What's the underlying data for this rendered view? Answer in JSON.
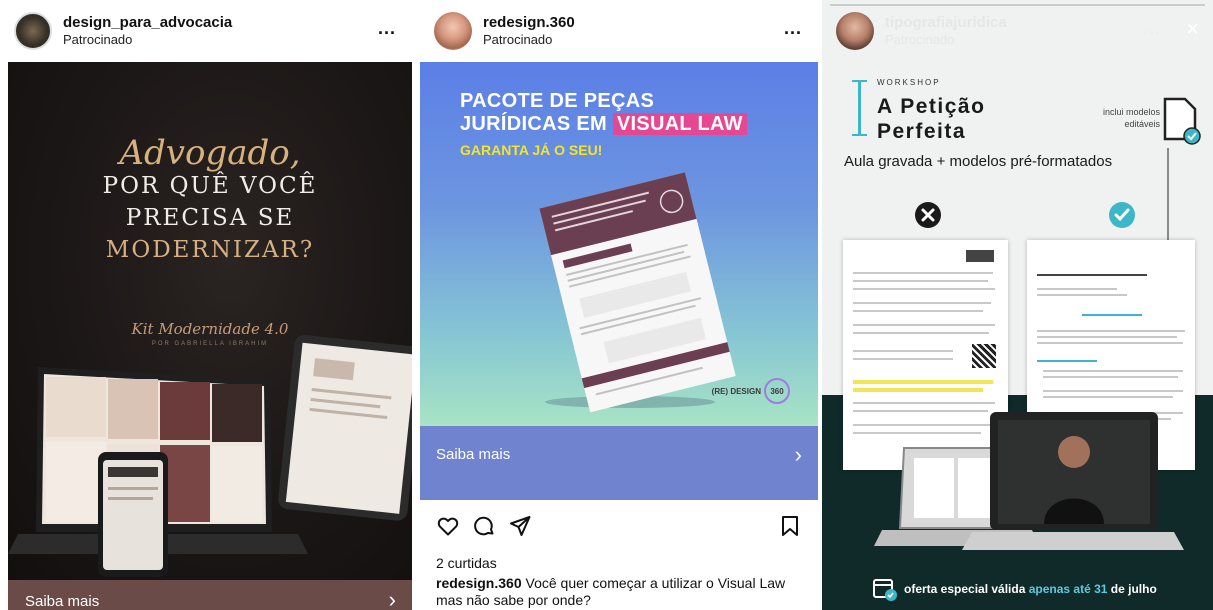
{
  "post1": {
    "username": "design_para_advocacia",
    "sponsored": "Patrocinado",
    "more_label": "...",
    "headline_script": "Advogado,",
    "headline_lines": [
      "POR QUÊ VOCÊ",
      "PRECISA SE",
      "MODERNIZAR?"
    ],
    "kit_label": "Kit Modernidade 4.0",
    "kit_author": "POR GABRIELLA IBRAHIM",
    "cta_label": "Saiba mais",
    "cta_chevron": "›"
  },
  "post2": {
    "username": "redesign.360",
    "sponsored": "Patrocinado",
    "more_label": "...",
    "headline_line1": "PACOTE DE PEÇAS",
    "headline_line2_prefix": "JURÍDICAS EM ",
    "headline_highlight": "VISUAL LAW",
    "subheadline": "GARANTA JÁ O SEU!",
    "brand_mark": "(RE) DESIGN",
    "brand_number": "360",
    "cta_label": "Saiba mais",
    "cta_chevron": "›",
    "likes": "2 curtidas",
    "caption_user": "redesign.360",
    "caption_text": " Você quer começar a utilizar o Visual Law mas não sabe por onde?"
  },
  "post3": {
    "username": "tipografiajuridica",
    "sponsored": "Patrocinado",
    "more_label": "...",
    "close_icon": "×",
    "workshop_label": "WORKSHOP",
    "title_line1": "A Petição",
    "title_line2": "Perfeita",
    "includes_label": "inclui modelos editáveis",
    "subtitle": "Aula gravada + modelos pré-formatados",
    "offer_prefix": "oferta especial válida ",
    "offer_highlight": "apenas até 31",
    "offer_suffix": " de julho",
    "colors": {
      "accent": "#3cb7c9",
      "bad": "#1a1a1a",
      "footer_bg": "#0f2a28"
    }
  }
}
